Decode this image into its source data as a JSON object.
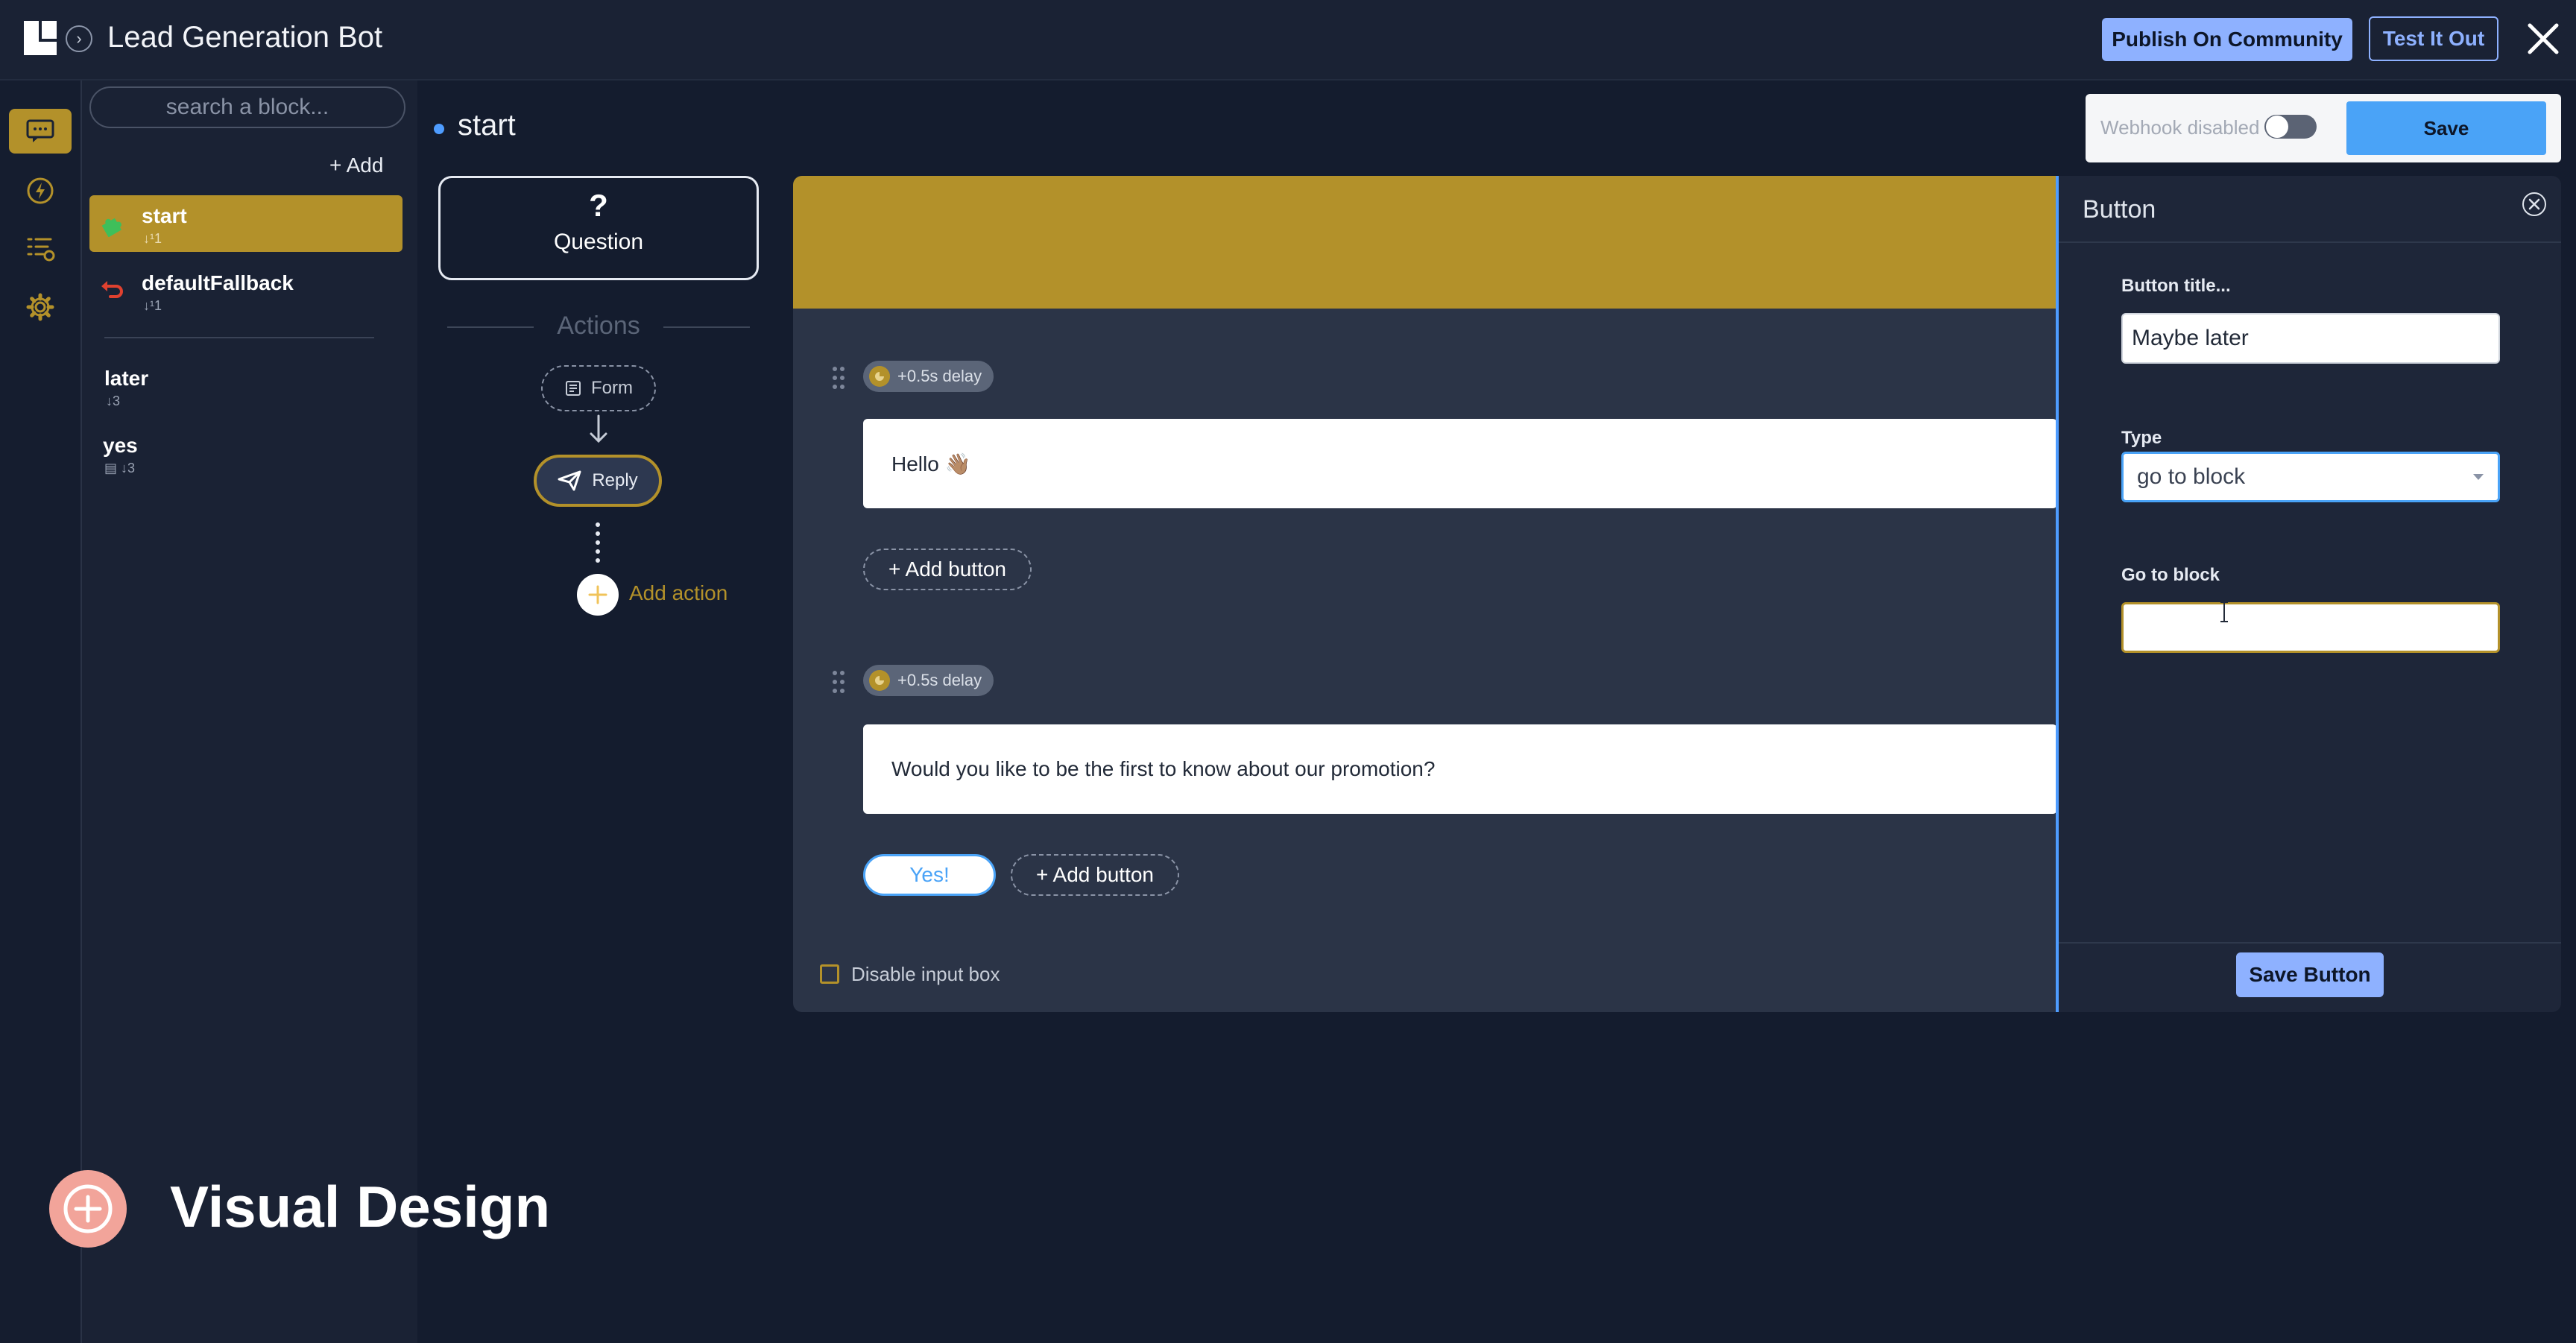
{
  "app": {
    "title": "Lead Generation Bot",
    "publish_label": "Publish On Community",
    "test_label": "Test It Out"
  },
  "rail": {
    "items": [
      {
        "icon": "chat-icon",
        "active": true
      },
      {
        "icon": "lightning-icon",
        "active": false
      },
      {
        "icon": "list-icon",
        "active": false
      },
      {
        "icon": "gear-icon",
        "active": false
      }
    ]
  },
  "sidebar": {
    "search_placeholder": "search a block...",
    "add_label": "+ Add",
    "blocks": [
      {
        "name": "start",
        "meta": "↓¹1",
        "icon": "puzzle-icon",
        "active": true
      },
      {
        "name": "defaultFallback",
        "meta": "↓¹1",
        "icon": "undo-icon",
        "active": false
      },
      {
        "name": "later",
        "meta": "↓3",
        "icon": "",
        "active": false
      },
      {
        "name": "yes",
        "meta": "▤ ↓3",
        "icon": "",
        "active": false
      }
    ]
  },
  "main": {
    "block_title": "start",
    "webhook_label": "Webhook disabled",
    "save_label": "Save",
    "question_mark": "?",
    "question_label": "Question",
    "actions_label": "Actions",
    "form_label": "Form",
    "reply_label": "Reply",
    "add_action_label": "Add action"
  },
  "editor": {
    "messages": [
      {
        "delay": "+0.5s delay",
        "text": "Hello 👋🏽",
        "buttons": [],
        "add_button": "+ Add button"
      },
      {
        "delay": "+0.5s delay",
        "text": "Would you like to be the first to know about our promotion?",
        "buttons": [
          "Yes!"
        ],
        "add_button": "+ Add button"
      }
    ],
    "disable_input_label": "Disable input box"
  },
  "button_panel": {
    "title": "Button",
    "title_label": "Button title...",
    "title_value": "Maybe later",
    "type_label": "Type",
    "type_value": "go to block",
    "goto_label": "Go to block",
    "goto_value": "",
    "save_label": "Save Button"
  },
  "overlay": {
    "caption": "Visual Design"
  },
  "colors": {
    "accent_gold": "#b3912a",
    "accent_blue": "#4aa3f7",
    "button_blue": "#8eb1ff",
    "background": "#141c2e"
  }
}
